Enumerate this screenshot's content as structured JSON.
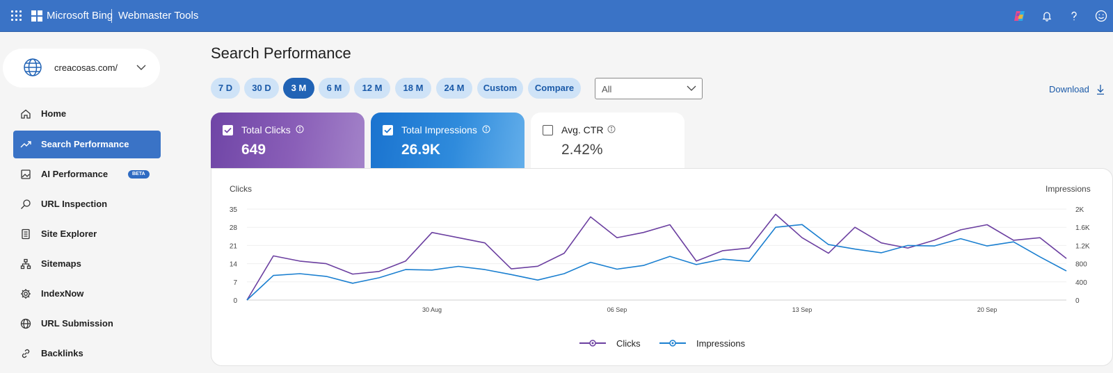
{
  "topbar": {
    "brand": "Microsoft Bing",
    "product": "Webmaster Tools"
  },
  "sidebar": {
    "site": "creacosas.com/",
    "items": [
      {
        "label": "Home",
        "icon": "home-icon"
      },
      {
        "label": "Search Performance",
        "icon": "trend-icon",
        "active": true
      },
      {
        "label": "AI Performance",
        "icon": "ai-image-icon",
        "badge": "BETA"
      },
      {
        "label": "URL Inspection",
        "icon": "magnifier-icon"
      },
      {
        "label": "Site Explorer",
        "icon": "document-list-icon"
      },
      {
        "label": "Sitemaps",
        "icon": "sitemap-icon"
      },
      {
        "label": "IndexNow",
        "icon": "gear-icon"
      },
      {
        "label": "URL Submission",
        "icon": "globe-icon"
      },
      {
        "label": "Backlinks",
        "icon": "link-icon"
      }
    ]
  },
  "main": {
    "title": "Search Performance",
    "ranges": [
      "7 D",
      "30 D",
      "3 M",
      "6 M",
      "12 M",
      "18 M",
      "24 M",
      "Custom",
      "Compare"
    ],
    "active_range": "3 M",
    "filter": {
      "value": "All"
    },
    "download_label": "Download"
  },
  "metrics": [
    {
      "label": "Total Clicks",
      "value": "649",
      "checked": true,
      "color": "#7446a8"
    },
    {
      "label": "Total Impressions",
      "value": "26.9K",
      "checked": true,
      "color": "#1a73cf"
    },
    {
      "label": "Avg. CTR",
      "value": "2.42%",
      "checked": false,
      "color": "#ffffff"
    }
  ],
  "chart_data": {
    "type": "line",
    "left_axis_label": "Clicks",
    "right_axis_label": "Impressions",
    "left_ticks": [
      "35",
      "28",
      "21",
      "14",
      "7",
      "0"
    ],
    "right_ticks": [
      "2K",
      "1.6K",
      "1.2K",
      "800",
      "400",
      "0"
    ],
    "x_tick_labels": [
      "30 Aug",
      "06 Sep",
      "13 Sep",
      "20 Sep"
    ],
    "ylim_left": [
      0,
      35
    ],
    "ylim_right": [
      0,
      2000
    ],
    "x": [
      "23 Aug",
      "24 Aug",
      "25 Aug",
      "26 Aug",
      "27 Aug",
      "28 Aug",
      "29 Aug",
      "30 Aug",
      "31 Aug",
      "01 Sep",
      "02 Sep",
      "03 Sep",
      "04 Sep",
      "05 Sep",
      "06 Sep",
      "07 Sep",
      "08 Sep",
      "09 Sep",
      "10 Sep",
      "11 Sep",
      "12 Sep",
      "13 Sep",
      "14 Sep",
      "15 Sep",
      "16 Sep",
      "17 Sep",
      "18 Sep",
      "19 Sep",
      "20 Sep",
      "21 Sep",
      "22 Sep",
      "23 Sep",
      "24 Sep",
      "25 Sep",
      "26 Sep",
      "27 Sep",
      "28 Sep"
    ],
    "series": [
      {
        "name": "Clicks",
        "axis": "left",
        "color": "#6b3fa0",
        "values": [
          0,
          17,
          15,
          14,
          10,
          11,
          15,
          26,
          24,
          22,
          12,
          13,
          18,
          32,
          24,
          26,
          29,
          15,
          19,
          20,
          33,
          24,
          18,
          28,
          22,
          20,
          23,
          27,
          29,
          23,
          24,
          16
        ]
      },
      {
        "name": "Impressions",
        "axis": "right",
        "color": "#1a7fd0",
        "values": [
          0,
          540,
          580,
          520,
          370,
          490,
          670,
          660,
          740,
          670,
          560,
          440,
          580,
          830,
          680,
          760,
          960,
          780,
          900,
          850,
          1600,
          1660,
          1220,
          1120,
          1040,
          1200,
          1190,
          1350,
          1190,
          1280,
          950,
          640
        ]
      }
    ],
    "grid": "horizontal",
    "legend_position": "bottom-center"
  }
}
